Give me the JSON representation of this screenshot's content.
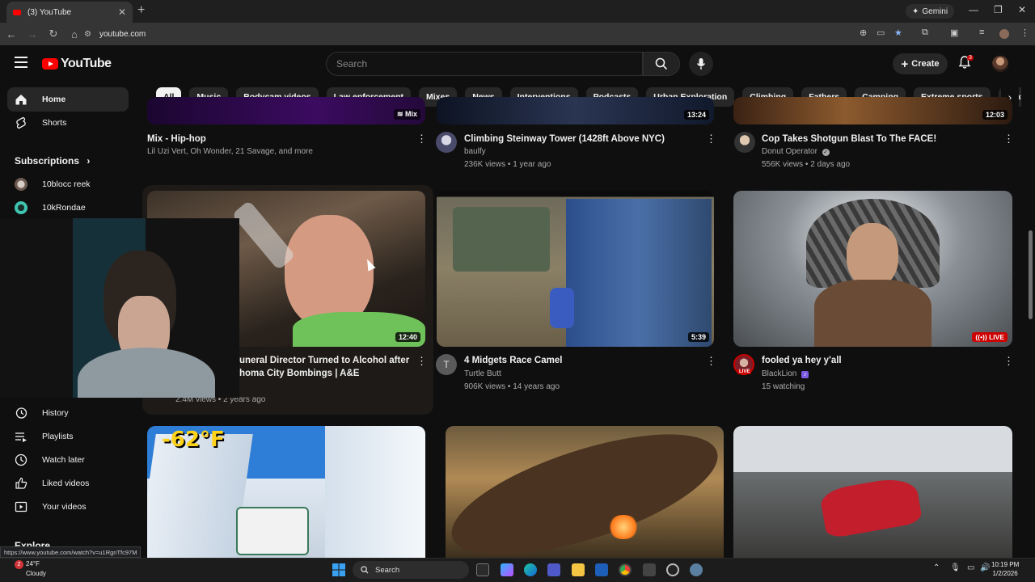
{
  "browser": {
    "tab_title": "(3) YouTube",
    "url": "youtube.com",
    "gemini_label": "Gemini",
    "status_url": "https://www.youtube.com/watch?v=u1RgnTfc97M"
  },
  "masthead": {
    "logo_text": "YouTube",
    "search_placeholder": "Search",
    "create_label": "Create",
    "notification_count": "3"
  },
  "chips": [
    "All",
    "Music",
    "Bodycam videos",
    "Law enforcement",
    "Mixes",
    "News",
    "Interventions",
    "Podcasts",
    "Urban Exploration",
    "Climbing",
    "Fathers",
    "Camping",
    "Extreme sports",
    "Skateboarding"
  ],
  "sidebar": {
    "home": "Home",
    "shorts": "Shorts",
    "subscriptions": "Subscriptions",
    "channels": [
      "10blocc reek",
      "10kRondae"
    ],
    "you_items": [
      "History",
      "Playlists",
      "Watch later",
      "Liked videos",
      "Your videos"
    ],
    "explore": "Explore"
  },
  "videos": {
    "row1": [
      {
        "title": "Mix - Hip-hop",
        "meta": "Lil Uzi Vert, Oh Wonder, 21 Savage, and more",
        "badge": "Mix"
      },
      {
        "title": "Climbing Steinway Tower (1428ft Above NYC)",
        "channel": "baulfy",
        "meta": "236K views • 1 year ago",
        "duration": "13:24"
      },
      {
        "title": "Cop Takes Shotgun Blast To The FACE!",
        "channel": "Donut Operator",
        "meta": "556K views • 2 days ago",
        "duration": "12:03"
      }
    ],
    "row2": [
      {
        "title_line1": "uneral Director Turned to Alcohol after",
        "title_line2": "homa City Bombings | A&E",
        "meta": "2.4M views • 2 years ago",
        "duration": "12:40"
      },
      {
        "title": "4 Midgets Race Camel",
        "channel": "Turtle Butt",
        "meta": "906K views • 14 years ago",
        "duration": "5:39",
        "avatar_letter": "T"
      },
      {
        "title": "fooled ya hey y'all",
        "channel": "BlackLion",
        "meta": "15 watching",
        "live_label": "LIVE",
        "avatar_live": "LIVE"
      }
    ],
    "row3": [
      {
        "overlay_text": "-62°F"
      }
    ]
  },
  "taskbar": {
    "temp": "24°F",
    "condition": "Cloudy",
    "weather_badge": "2",
    "search_label": "Search",
    "time": "10:19 PM",
    "date": "1/2/2026"
  },
  "colors": {
    "brand_red": "#ff0000",
    "background": "#0f0f0f",
    "chip_bg": "#272727"
  }
}
